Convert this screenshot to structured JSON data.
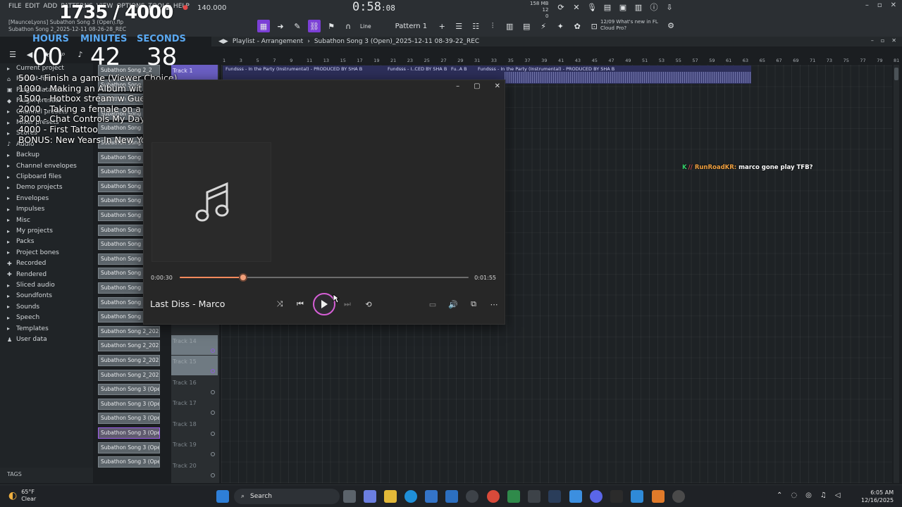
{
  "fl": {
    "menu": [
      "FILE",
      "EDIT",
      "ADD",
      "PATTERNS",
      "VIEW",
      "OPTIONS",
      "TOOLS",
      "HELP"
    ],
    "project_title_line1": "[MaunceLyons] Subathon Song 3 (Open).flp",
    "project_title_line2": "Subathon Song 2_2025-12-11 08-26-28_REC",
    "bpm": "140.000",
    "song_time": "0:58",
    "song_time_small": ":08",
    "memory": "158 MB",
    "memory_line2": "12",
    "memory_line3": "0",
    "line_tool": "Line",
    "pattern": "Pattern 1",
    "news_line1": "12/09  What's new in FL",
    "news_line2": "Cloud Pro?"
  },
  "overlay": {
    "counter": "1735 / 4000",
    "hours_label": "HOURS",
    "minutes_label": "MINUTES",
    "seconds_label": "SECONDS",
    "hours": "00",
    "minutes": "42",
    "seconds": "38",
    "goals": [
      "500 - Finish a game (Viewer Choice)",
      "1000 - Making an Album wit GizzyGio (Desktop)",
      "1500 - Hotbox stream w Guest (IRL Miami)",
      "2000 - Taking a female on a Date (IRL Miami)",
      "3000 - Chat Controls My Day (IRL Miami)",
      "4000 - First Tattoo",
      "BONUS: New Years In New York!"
    ]
  },
  "browser": {
    "items": [
      "Current project",
      "Recent files",
      "Plugin database",
      "Plugin presets",
      "Channel presets",
      "Mixer presets",
      "Scores",
      "Audio",
      "Backup",
      "Channel envelopes",
      "Clipboard files",
      "Demo projects",
      "Envelopes",
      "Impulses",
      "Misc",
      "My projects",
      "Packs",
      "Project bones",
      "Recorded",
      "Rendered",
      "Sliced audio",
      "Soundfonts",
      "Sounds",
      "Speech",
      "Templates",
      "User data"
    ],
    "tags_label": "TAGS",
    "files": [
      "Subathon Song 2_2",
      "Subathon Song 2_2",
      "Subathon Song 2_2",
      "Subathon Song 2_2",
      "Subathon Song 2_2",
      "Subathon Song 2_2",
      "Subathon Song 2_2",
      "Subathon Song 2_2",
      "Subathon Song 2_2",
      "Subathon Song 2_2",
      "Subathon Song 2_2",
      "Subathon Song 2_2",
      "Subathon Song 2_2",
      "Subathon Song 2_2",
      "Subathon Song 2_2",
      "Subathon Song 2_2",
      "Subathon Song 2_2",
      "Subathon Song 2_2025-1...",
      "Subathon Song 2_2025-1...",
      "Subathon Song 2_2025-1...",
      "Subathon Song 2_2025-1...",
      "Subathon Song 2_2025-1...",
      "Subathon Song 3 (Open)...",
      "Subathon Song 3 (Open)...",
      "Subathon Song 3 (Open)...",
      "Subathon Song 3 (Open)...",
      "Subathon Song 3 (Open)...",
      "Subathon Song 3 (Open)..."
    ]
  },
  "playlist": {
    "header": "Playlist - Arrangement",
    "crumb": "Subathon Song 3 (Open)_2025-12-11 08-39-22_REC",
    "ruler": [
      "1",
      "3",
      "5",
      "7",
      "9",
      "11",
      "13",
      "15",
      "17",
      "19",
      "21",
      "23",
      "25",
      "27",
      "29",
      "31",
      "33",
      "35",
      "37",
      "39",
      "41",
      "43",
      "45",
      "47",
      "49",
      "51",
      "53",
      "55",
      "57",
      "59",
      "61",
      "63",
      "65",
      "67",
      "69",
      "71",
      "73",
      "75",
      "77",
      "79",
      "81"
    ],
    "tracks": [
      "Track 1",
      "Track 14",
      "Track 15",
      "Track 16",
      "Track 17",
      "Track 18",
      "Track 19",
      "Track 20"
    ],
    "clips": [
      "Fundsss - In the Party (Instrumental) - PRODUCED BY SHA B",
      "Fundsss - I..CED BY SHA B",
      "Fu..A B",
      "Fundsss - In the Party (Instrumental) - PRODUCED BY SHA B"
    ]
  },
  "chat": {
    "user": "RunRoadKR:",
    "message": "marco gone play TFB?",
    "badge_1": "K",
    "badge_2": "//"
  },
  "player": {
    "title": "Last Diss - Marco",
    "current_time": "0:00:30",
    "duration": "0:01:55",
    "progress": 0.22
  },
  "taskbar": {
    "temp": "65°F",
    "condition": "Clear",
    "search_placeholder": "Search",
    "time": "6:05 AM",
    "date": "12/16/2025"
  }
}
